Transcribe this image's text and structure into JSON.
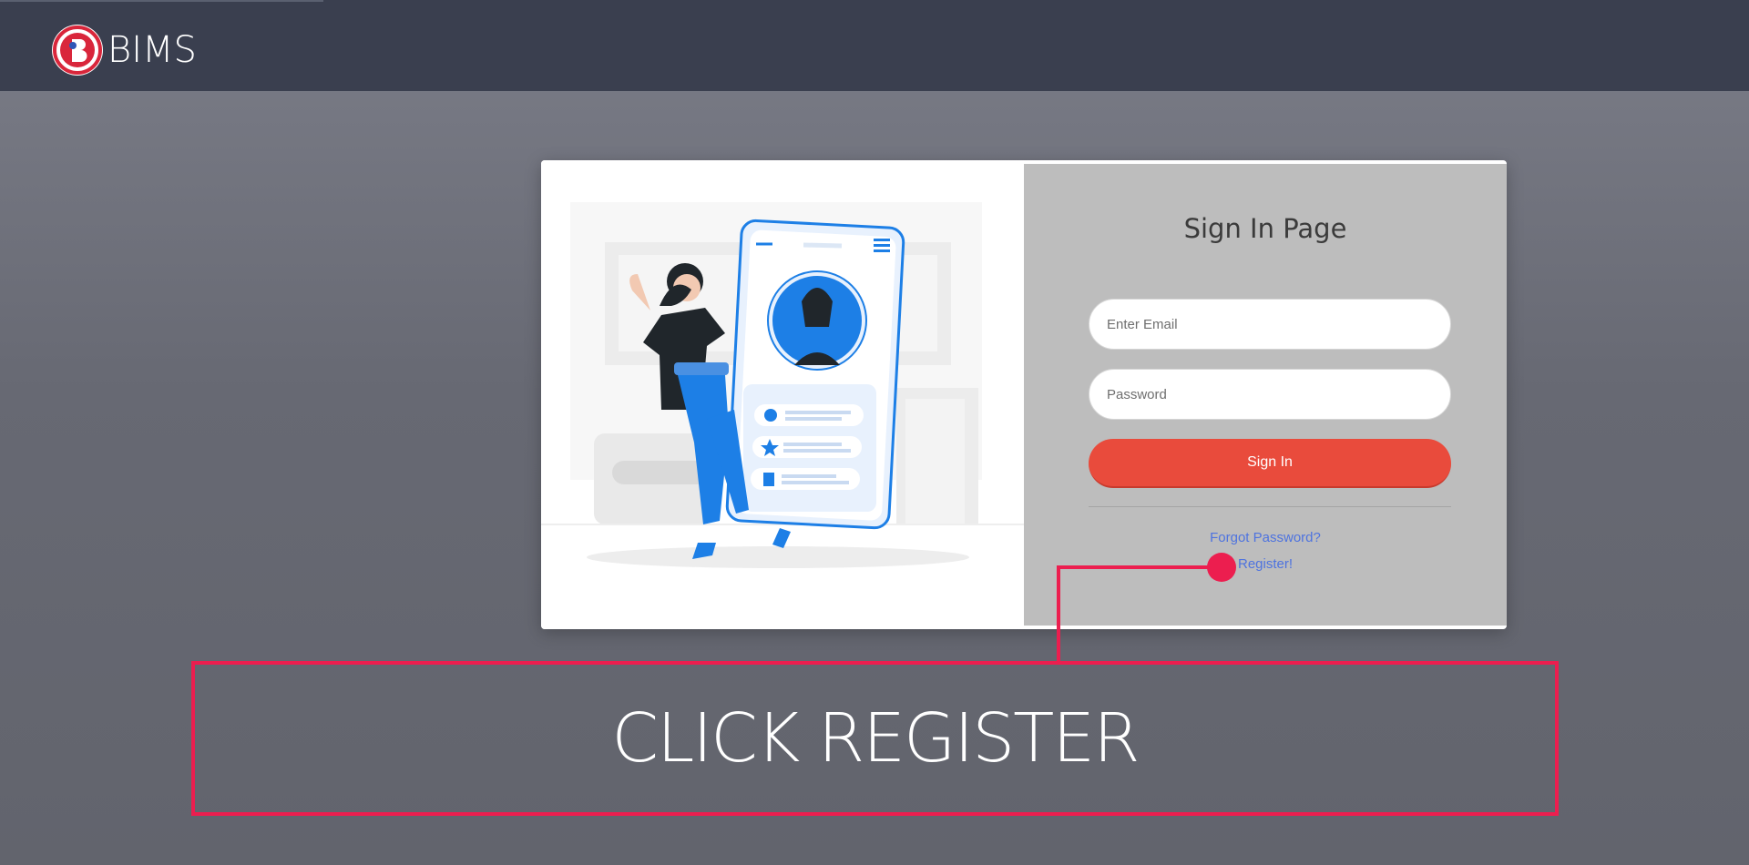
{
  "header": {
    "brand": "BIMS",
    "logo_icon": "bims-logo-icon"
  },
  "signin": {
    "title": "Sign In Page",
    "email_placeholder": "Enter Email",
    "password_placeholder": "Password",
    "signin_label": "Sign In",
    "forgot_label": "Forgot Password?",
    "register_label": "Register!"
  },
  "annotation": {
    "text": "CLICK REGISTER"
  },
  "colors": {
    "header_bg": "#3a3f4f",
    "signin_button": "#e94b3c",
    "link": "#4e73df",
    "callout": "#ec1e4f",
    "illustration_accent": "#1d7fe6"
  }
}
